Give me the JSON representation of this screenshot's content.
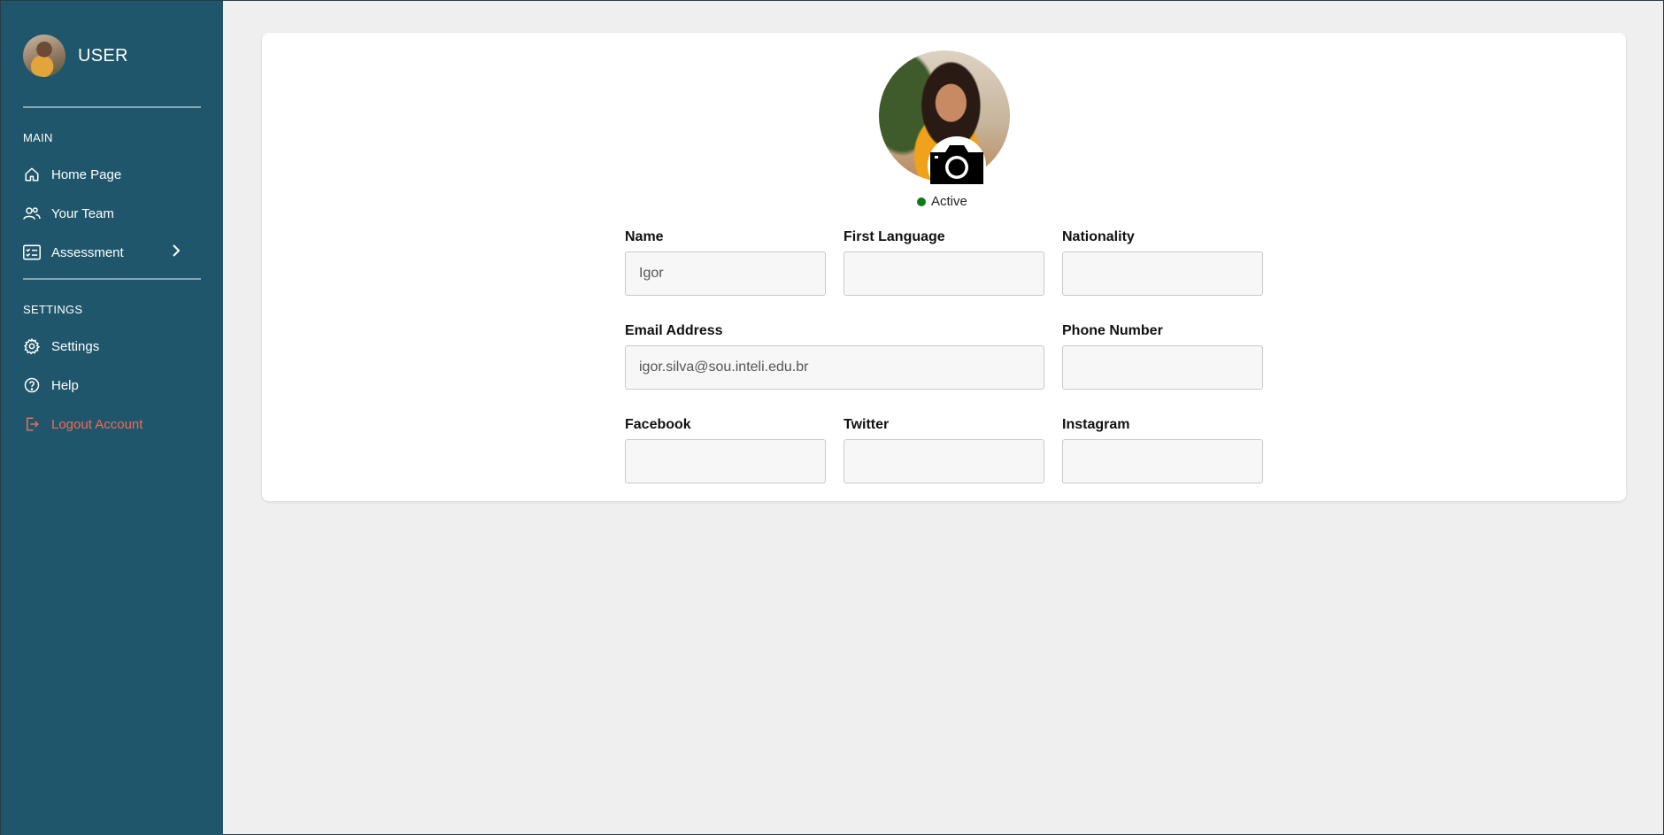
{
  "sidebar": {
    "user_name": "USER",
    "sections": {
      "main_label": "MAIN",
      "settings_label": "SETTINGS"
    },
    "items": {
      "home": "Home Page",
      "team": "Your Team",
      "assessment": "Assessment",
      "settings": "Settings",
      "help": "Help",
      "logout": "Logout Account"
    }
  },
  "profile": {
    "status": "Active",
    "fields": {
      "name": {
        "label": "Name",
        "value": "Igor"
      },
      "first_language": {
        "label": "First Language",
        "value": ""
      },
      "nationality": {
        "label": "Nationality",
        "value": ""
      },
      "email": {
        "label": "Email Address",
        "value": "igor.silva@sou.inteli.edu.br"
      },
      "phone": {
        "label": "Phone Number",
        "value": ""
      },
      "facebook": {
        "label": "Facebook",
        "value": ""
      },
      "twitter": {
        "label": "Twitter",
        "value": ""
      },
      "instagram": {
        "label": "Instagram",
        "value": ""
      }
    }
  },
  "colors": {
    "sidebar_bg": "#1f566b",
    "logout_text": "#f26b5b",
    "status_active": "#0f7a1a",
    "page_bg": "#efefef"
  },
  "icons": {
    "home": "home-icon",
    "team": "users-icon",
    "assessment": "checklist-icon",
    "settings": "gear-icon",
    "help": "question-icon",
    "logout": "logout-icon",
    "camera": "camera-icon"
  }
}
